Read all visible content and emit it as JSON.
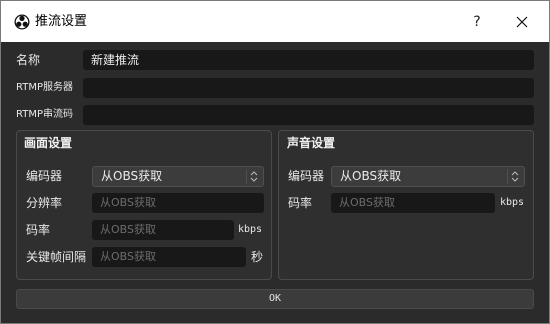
{
  "window": {
    "title": "推流设置",
    "help_label": "?",
    "close_icon": "close-icon",
    "app_icon": "obs-logo-icon"
  },
  "form": {
    "name_label": "名称",
    "name_value": "新建推流",
    "rtmp_server_label": "RTMP服务器",
    "rtmp_server_value": "",
    "rtmp_key_label": "RTMP串流码",
    "rtmp_key_value": ""
  },
  "video": {
    "title": "画面设置",
    "encoder_label": "编码器",
    "encoder_value": "从OBS获取",
    "resolution_label": "分辨率",
    "resolution_placeholder": "从OBS获取",
    "bitrate_label": "码率",
    "bitrate_placeholder": "从OBS获取",
    "bitrate_unit": "kbps",
    "keyframe_label": "关键帧间隔",
    "keyframe_placeholder": "从OBS获取",
    "keyframe_unit": "秒"
  },
  "audio": {
    "title": "声音设置",
    "encoder_label": "编码器",
    "encoder_value": "从OBS获取",
    "bitrate_label": "码率",
    "bitrate_placeholder": "从OBS获取",
    "bitrate_unit": "kbps"
  },
  "actions": {
    "ok_label": "OK"
  }
}
